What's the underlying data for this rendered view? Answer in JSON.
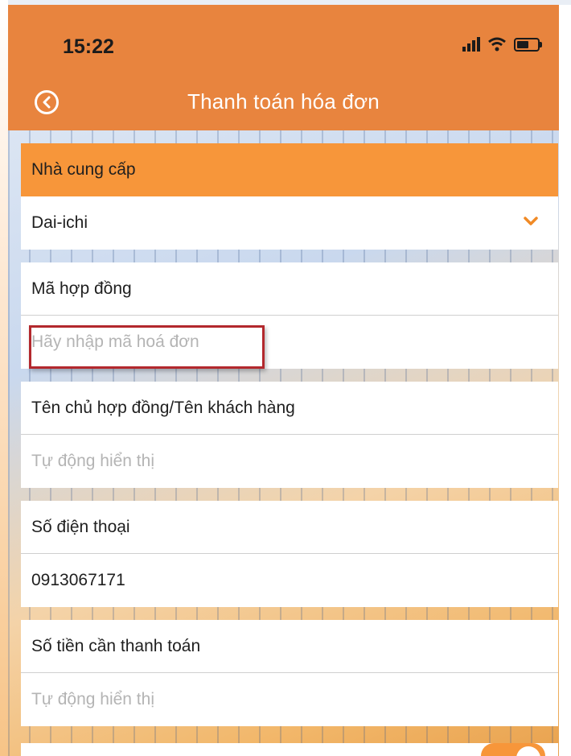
{
  "status_bar": {
    "time": "15:22"
  },
  "nav": {
    "title": "Thanh toán hóa đơn"
  },
  "form": {
    "provider": {
      "label": "Nhà cung cấp",
      "value": "Dai-ichi"
    },
    "contract": {
      "label": "Mã hợp đồng",
      "placeholder": "Hãy nhập mã hoá đơn"
    },
    "customer": {
      "label": "Tên chủ hợp đồng/Tên khách hàng",
      "placeholder": "Tự động hiển thị"
    },
    "phone": {
      "label": "Số điện thoại",
      "value": "0913067171"
    },
    "amount": {
      "label": "Số tiền cần thanh toán",
      "placeholder": "Tự động hiển thị"
    }
  },
  "colors": {
    "bar": "#e8843e",
    "header": "#f7963a",
    "highlight": "#b3282d"
  }
}
